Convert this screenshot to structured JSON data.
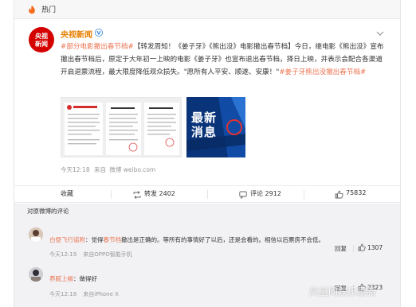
{
  "header": {
    "hot_label": "热门"
  },
  "account": {
    "name": "央视新闻",
    "avatar_line1": "央视",
    "avatar_line2": "新闻"
  },
  "post": {
    "text_parts": {
      "tag1": "#部分电影撤出春节档#",
      "body1": "【转发周知！《姜子牙》《熊出没》电影撤出春节档】今日，继电影《熊出没》宣布撤出春节档后，原定于大年初一上映的电影《姜子牙》也宣布退出春节档，择日上映，并表示会配合各渠道开启退票流程，最大限度降低观众损失。\"愿所有人平安、顺遂、安康！\"",
      "tag2": "#姜子牙熊出没撤出春节档#"
    },
    "image_news_line1": "最新",
    "image_news_line2": "消息",
    "time": "今天12:18",
    "source_prefix": "来自",
    "source": "微博 weibo.com"
  },
  "actions": {
    "favorite": "收藏",
    "repost": "转发 2402",
    "comment": "评论 2912",
    "like": "75832"
  },
  "comments": {
    "title": "对原微博的评论",
    "items": [
      {
        "user": "白昼飞行谣附",
        "text_before": "：觉得",
        "text_link": "春节档",
        "text_after": "撤出是正确的。等所有的事情好了以后，还是会看的。相信以后票房不会低。",
        "time": "今天12:19",
        "source": "来自OPPO智能手机",
        "reply_label": "回复",
        "likes": "1307"
      },
      {
        "user": "养腻上椒",
        "text": "：做得好",
        "time": "今天12:18",
        "source": "来自iPhone X",
        "reply_label": "回复",
        "likes": "2323"
      }
    ]
  },
  "watermark": "凤凰网娱乐最新"
}
